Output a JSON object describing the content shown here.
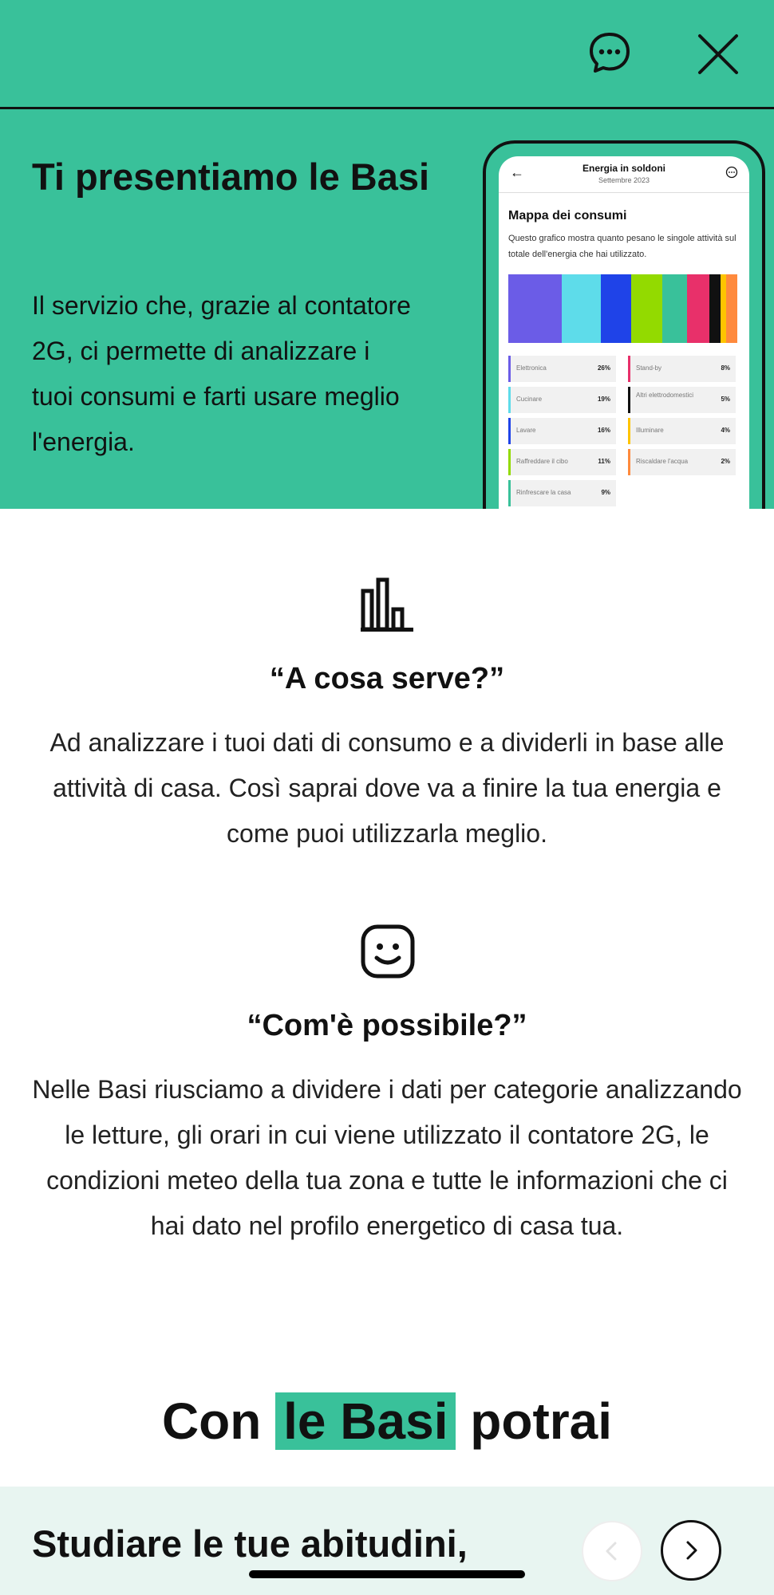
{
  "hero": {
    "title": "Ti presentiamo le Basi",
    "text": "Il servizio che, grazie al contatore 2G, ci permette di analizzare i tuoi consumi e farti usare meglio l'energia."
  },
  "phone": {
    "title": "Energia in soldoni",
    "subtitle": "Settembre 2023",
    "map_title": "Mappa dei consumi",
    "map_desc": "Questo grafico mostra quanto pesano le singole attività sul totale dell'energia che hai utilizzato.",
    "bar_colors": [
      "#6B5CE7",
      "#5EDCEA",
      "#1F43E8",
      "#93DA00",
      "#39C19A",
      "#E8306A",
      "#111111",
      "#FFC400",
      "#FF8A3D"
    ],
    "bar_shares": [
      19,
      14,
      11,
      11,
      9,
      8,
      4,
      2,
      4
    ],
    "legend": [
      {
        "label": "Elettronica",
        "value": "26%",
        "color": "#6B5CE7"
      },
      {
        "label": "Stand-by",
        "value": "8%",
        "color": "#E8306A"
      },
      {
        "label": "Cucinare",
        "value": "19%",
        "color": "#5EDCEA"
      },
      {
        "label": "Altri elettrodomestici",
        "value": "5%",
        "color": "#111111"
      },
      {
        "label": "Lavare",
        "value": "16%",
        "color": "#1F43E8"
      },
      {
        "label": "Illuminare",
        "value": "4%",
        "color": "#FFC400"
      },
      {
        "label": "Raffreddare il cibo",
        "value": "11%",
        "color": "#93DA00"
      },
      {
        "label": "Riscaldare l'acqua",
        "value": "2%",
        "color": "#FF8A3D"
      },
      {
        "label": "Rinfrescare la casa",
        "value": "9%",
        "color": "#39C19A"
      }
    ]
  },
  "sections": [
    {
      "icon": "bar-chart-icon",
      "title": "“A cosa serve?”",
      "text": "Ad analizzare i tuoi dati di consumo e a dividerli in base alle attività di casa. Così saprai dove va a finire la tua energia e come puoi utilizzarla meglio."
    },
    {
      "icon": "smiley-face-icon",
      "title": "“Com'è possibile?”",
      "text": "Nelle Basi riusciamo a dividere i dati per categorie analizzando le letture, gli orari in cui viene utilizzato il contatore 2G, le condizioni meteo della tua zona e tutte le informazioni che ci hai dato nel profilo energetico di casa tua."
    }
  ],
  "potrai": {
    "before": "Con",
    "highlight": "le Basi",
    "after": "potrai"
  },
  "carousel": {
    "text": "Studiare le tue abitudini,"
  },
  "colors": {
    "brand": "#39C19A",
    "light_bg": "#E8F5F1"
  }
}
